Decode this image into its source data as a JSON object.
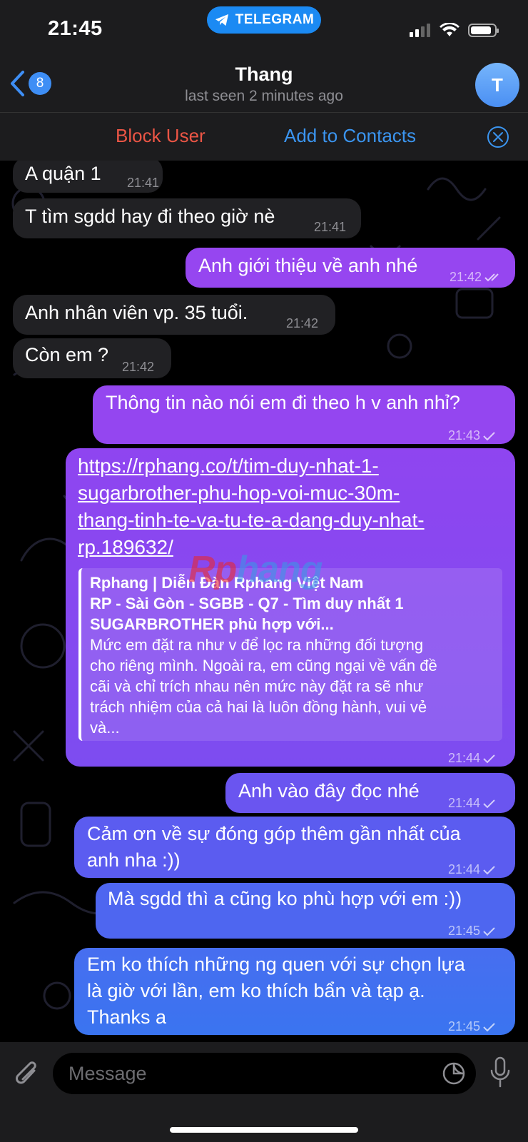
{
  "status_bar": {
    "time": "21:45",
    "app_pill": "TELEGRAM"
  },
  "header": {
    "back_count": "8",
    "contact_name": "Thang",
    "last_seen": "last seen 2 minutes ago",
    "avatar_initial": "T"
  },
  "action_bar": {
    "block": "Block User",
    "add": "Add to Contacts"
  },
  "messages": [
    {
      "dir": "in",
      "text": "A quận 1",
      "time": "21:41"
    },
    {
      "dir": "in",
      "text": "T tìm sgdd hay đi theo giờ nè",
      "time": "21:41"
    },
    {
      "dir": "out",
      "text": "Anh giới thiệu về anh nhé",
      "time": "21:42",
      "status": "read"
    },
    {
      "dir": "in",
      "text": "Anh nhân viên vp. 35 tuổi.",
      "time": "21:42"
    },
    {
      "dir": "in",
      "text": "Còn em ?",
      "time": "21:42"
    },
    {
      "dir": "out",
      "text": "Thông tin nào nói em đi theo h v anh nhỉ?",
      "time": "21:43",
      "status": "sent"
    },
    {
      "dir": "out",
      "link": "https://rphang.co/t/tim-duy-nhat-1-\nsugarbrother-phu-hop-voi-muc-30m-\nthang-tinh-te-va-tu-te-a-dang-duy-nhat-\nrp.189632/",
      "time": "21:44",
      "status": "sent",
      "preview": {
        "site": "Rphang | Diễn Đàn Rphang Việt Nam",
        "title": "RP - Sài Gòn - SGBB - Q7 - Tìm duy nhất 1\nSUGARBROTHER phù hợp với...",
        "description": "Mức em đặt ra như v để lọc ra những đối tượng\ncho riêng mình. Ngoài ra, em cũng ngại về vấn đề\ncãi và chỉ trích nhau nên mức này đặt ra sẽ như\ntrách nhiệm của cả hai là luôn đồng hành, vui vẻ\nvà..."
      }
    },
    {
      "dir": "out",
      "text": "Anh vào đây đọc nhé",
      "time": "21:44",
      "status": "sent"
    },
    {
      "dir": "out",
      "text": "Cảm ơn về sự đóng góp thêm gần nhất của\nanh nha :))",
      "time": "21:44",
      "status": "sent"
    },
    {
      "dir": "out",
      "text": "Mà sgdd thì a cũng ko phù hợp với em :))",
      "time": "21:45",
      "status": "sent"
    },
    {
      "dir": "out",
      "text": "Em ko thích những ng quen với sự chọn lựa\nlà giờ với lần, em ko thích bẩn và tạp ạ.\nThanks a",
      "time": "21:45",
      "status": "sent"
    }
  ],
  "watermark": {
    "part1": "Rp",
    "part2": "hang"
  },
  "input": {
    "placeholder": "Message"
  },
  "colors": {
    "bubble_out_top": "#9d44f0",
    "bubble_out_bottom": "#3a6ff0",
    "bubble_in": "#212124",
    "block": "#eb5545",
    "accent": "#3b95f0"
  }
}
